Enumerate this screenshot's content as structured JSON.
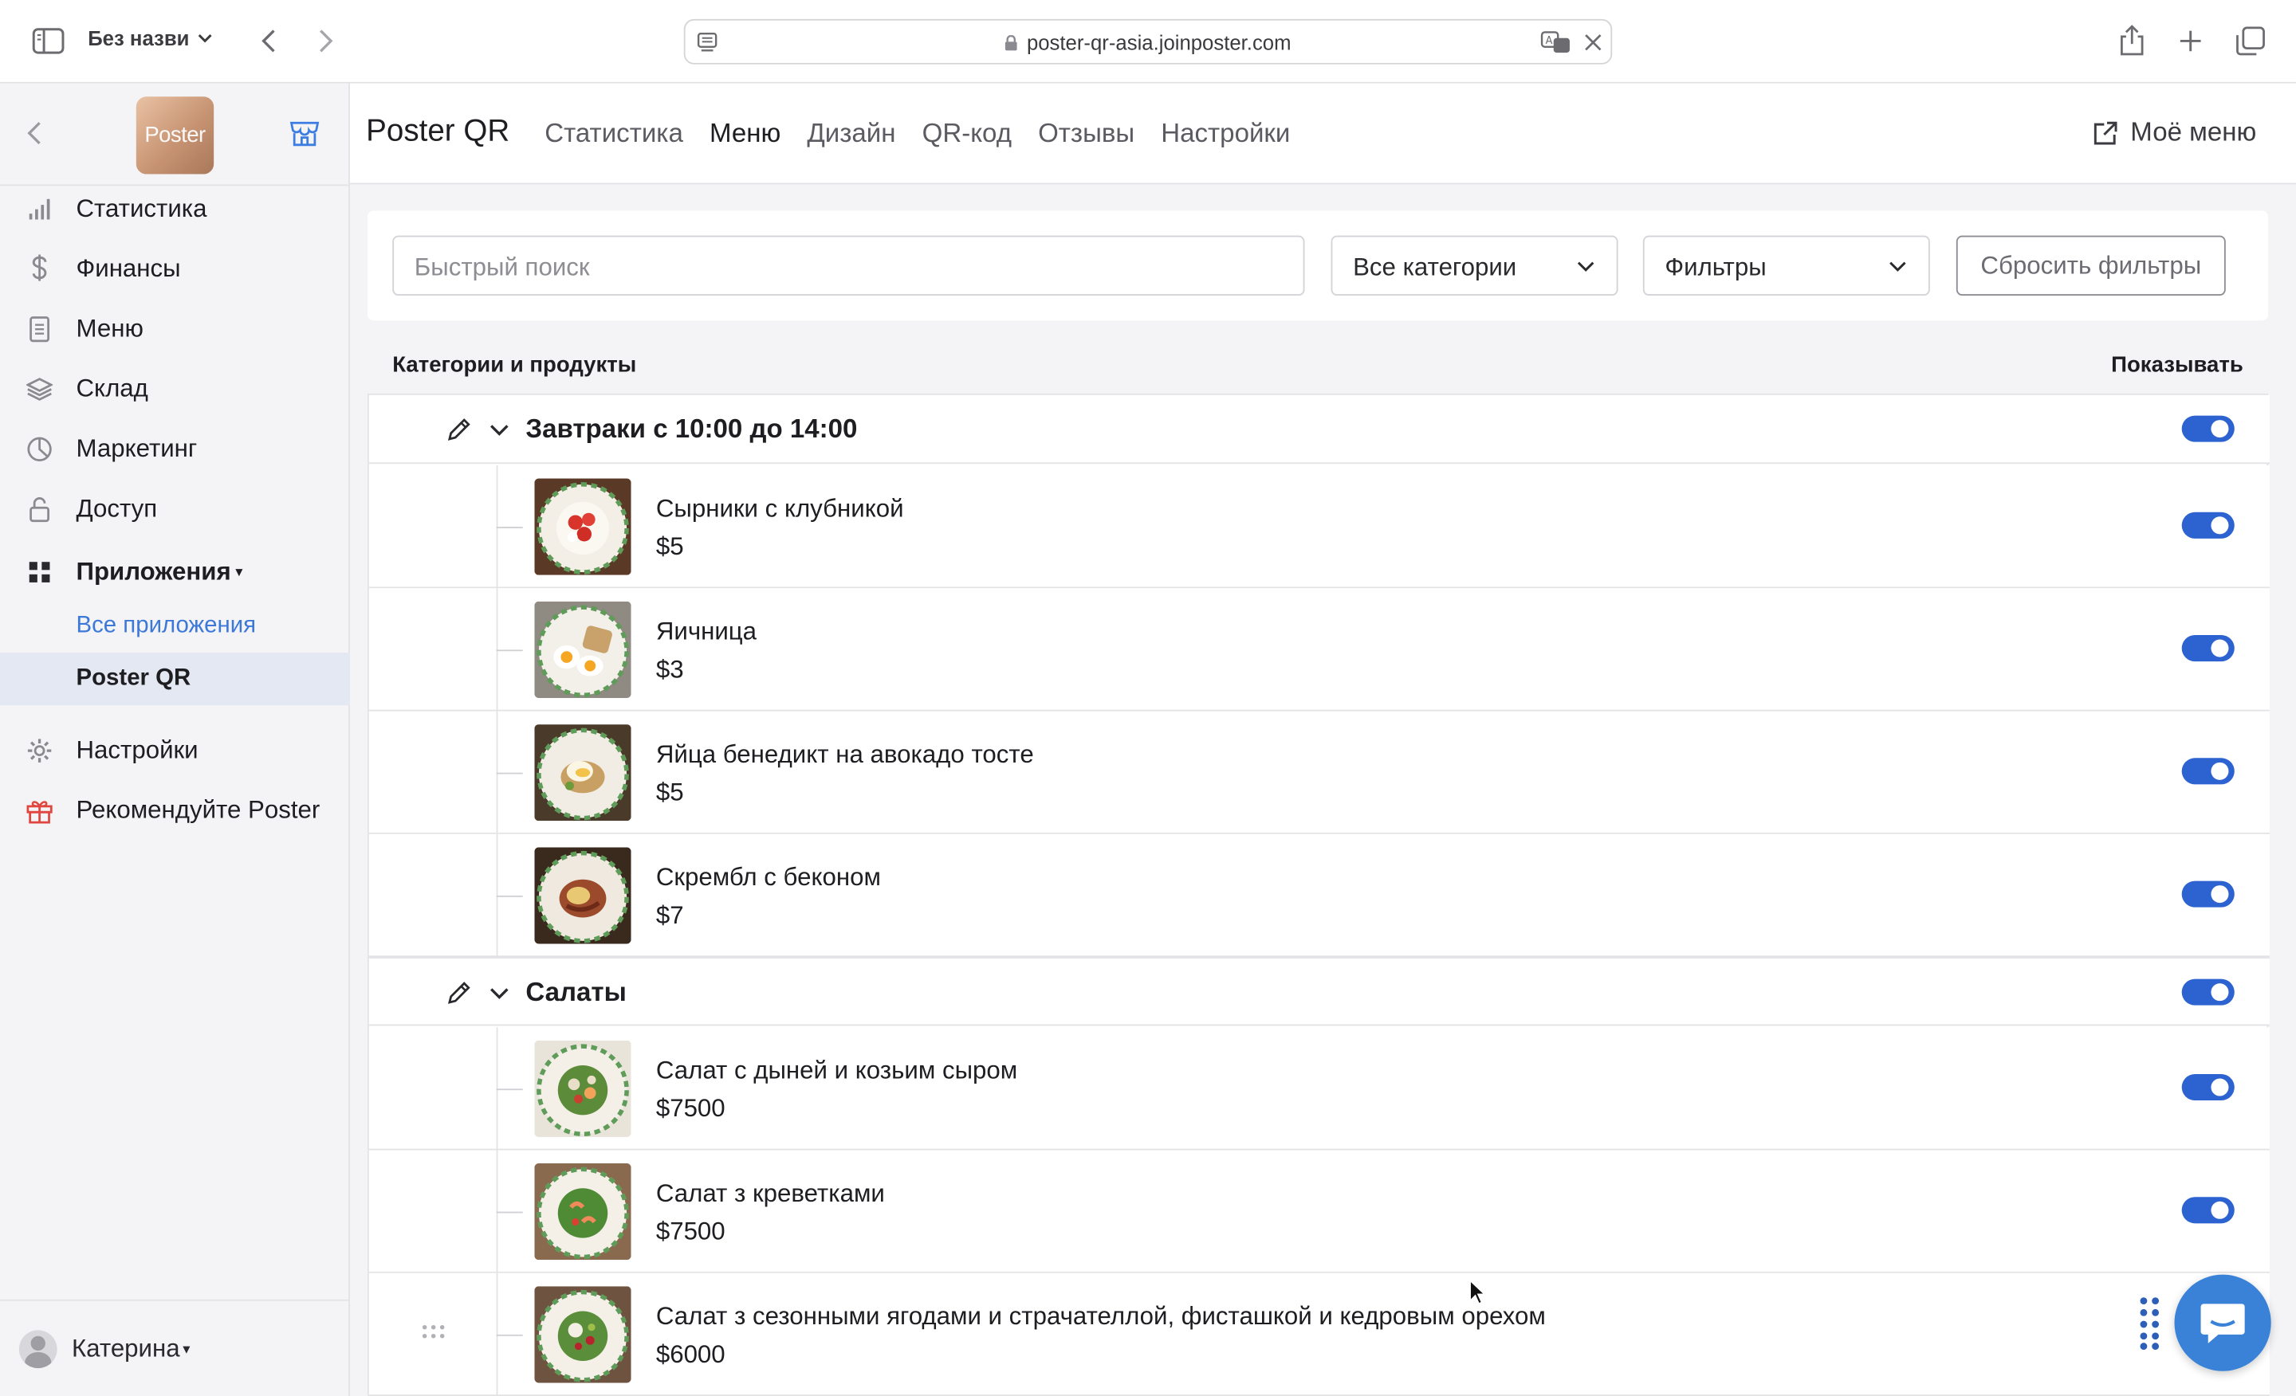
{
  "browser": {
    "window_title": "Без назви",
    "url": "poster-qr-asia.joinposter.com"
  },
  "sidebar": {
    "logo_text": "Poster",
    "items": [
      {
        "label": "Статистика",
        "icon": "bar-chart-icon"
      },
      {
        "label": "Финансы",
        "icon": "dollar-icon"
      },
      {
        "label": "Меню",
        "icon": "document-icon"
      },
      {
        "label": "Склад",
        "icon": "layers-icon"
      },
      {
        "label": "Маркетинг",
        "icon": "pie-icon"
      },
      {
        "label": "Доступ",
        "icon": "lock-icon"
      },
      {
        "label": "Приложения",
        "icon": "grid-icon"
      },
      {
        "label": "Все приложения"
      },
      {
        "label": "Poster QR"
      },
      {
        "label": "Настройки",
        "icon": "gear-icon"
      },
      {
        "label": "Рекомендуйте Poster",
        "icon": "gift-icon"
      }
    ],
    "user_name": "Катерина"
  },
  "header": {
    "app_title": "Poster QR",
    "tabs": [
      {
        "label": "Статистика"
      },
      {
        "label": "Меню",
        "active": true
      },
      {
        "label": "Дизайн"
      },
      {
        "label": "QR-код"
      },
      {
        "label": "Отзывы"
      },
      {
        "label": "Настройки"
      }
    ],
    "my_menu_label": "Моё меню"
  },
  "filters": {
    "search_placeholder": "Быстрый поиск",
    "categories_select": "Все категории",
    "filters_select": "Фильтры",
    "reset_label": "Сбросить фильтры"
  },
  "list": {
    "col_left": "Категории и продукты",
    "col_right": "Показывать",
    "categories": [
      {
        "name": "Завтраки с 10:00 до 14:00",
        "visible": true,
        "products": [
          {
            "name": "Сырники с клубникой",
            "price": "$5",
            "visible": true
          },
          {
            "name": "Яичница",
            "price": "$3",
            "visible": true
          },
          {
            "name": "Яйца бенедикт на авокадо тосте",
            "price": "$5",
            "visible": true
          },
          {
            "name": "Скрембл с беконом",
            "price": "$7",
            "visible": true
          }
        ]
      },
      {
        "name": "Салаты",
        "visible": true,
        "products": [
          {
            "name": "Салат с дыней и козьим сыром",
            "price": "$7500",
            "visible": true
          },
          {
            "name": "Салат з креветками",
            "price": "$7500",
            "visible": true
          },
          {
            "name": "Салат з сезонными ягодами и страчателлой, фисташкой и кедровым орехом",
            "price": "$6000",
            "visible": true
          }
        ]
      }
    ]
  },
  "colors": {
    "accent": "#2d63d0",
    "link": "#3c78d8",
    "chat": "#3a82d8",
    "gift": "#e0463f"
  }
}
